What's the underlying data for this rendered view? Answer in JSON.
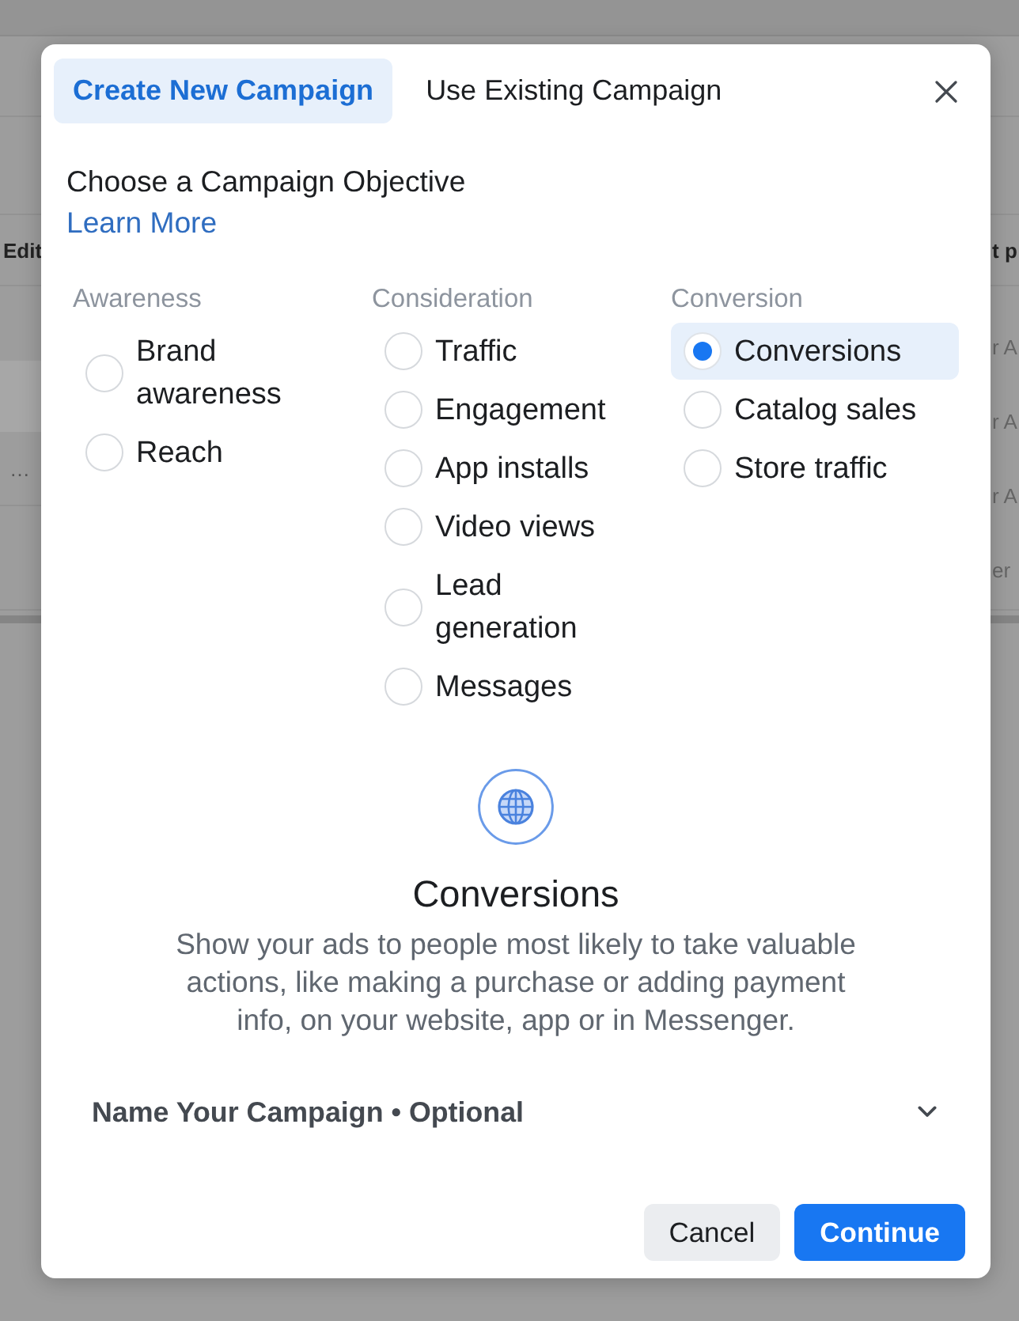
{
  "background_page": {
    "header_left": "Edit",
    "header_right": "t p",
    "left_row_text": "…",
    "right_row_texts": [
      "r A",
      "r A",
      "r A",
      "er"
    ]
  },
  "dialog": {
    "tabs": [
      {
        "label": "Create New Campaign",
        "selected": true
      },
      {
        "label": "Use Existing Campaign",
        "selected": false
      }
    ],
    "heading": "Choose a Campaign Objective",
    "link": "Learn More",
    "groups": [
      {
        "title": "Awareness",
        "options": [
          {
            "label": "Brand awareness",
            "selected": false
          },
          {
            "label": "Reach",
            "selected": false
          }
        ]
      },
      {
        "title": "Consideration",
        "options": [
          {
            "label": "Traffic",
            "selected": false
          },
          {
            "label": "Engagement",
            "selected": false
          },
          {
            "label": "App installs",
            "selected": false
          },
          {
            "label": "Video views",
            "selected": false
          },
          {
            "label": "Lead generation",
            "selected": false
          },
          {
            "label": "Messages",
            "selected": false
          }
        ]
      },
      {
        "title": "Conversion",
        "options": [
          {
            "label": "Conversions",
            "selected": true
          },
          {
            "label": "Catalog sales",
            "selected": false
          },
          {
            "label": "Store traffic",
            "selected": false
          }
        ]
      }
    ],
    "detail": {
      "title": "Conversions",
      "description": "Show your ads to people most likely to take valuable actions, like making a purchase or adding payment info, on your website, app or in Messenger."
    },
    "name_section": {
      "label": "Name Your Campaign • Optional",
      "expanded": false
    },
    "buttons": [
      {
        "label": "Cancel",
        "kind": "secondary"
      },
      {
        "label": "Continue",
        "kind": "primary"
      }
    ]
  }
}
